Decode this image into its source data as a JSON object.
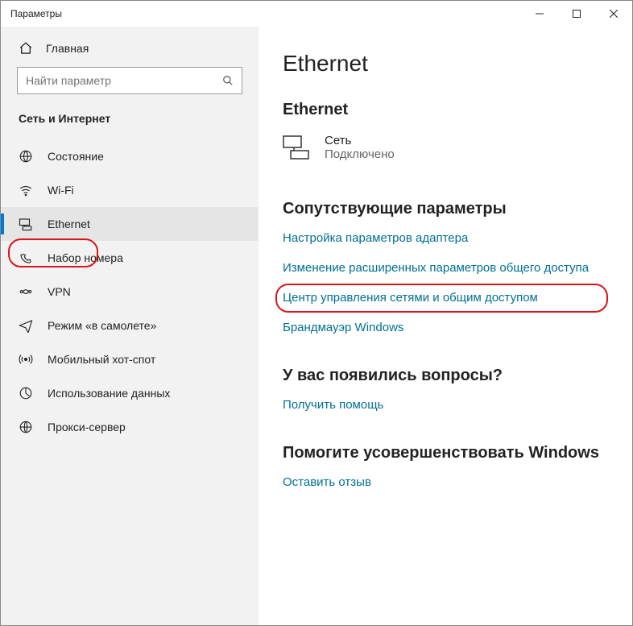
{
  "window": {
    "title": "Параметры"
  },
  "sidebar": {
    "home": "Главная",
    "search_placeholder": "Найти параметр",
    "section": "Сеть и Интернет",
    "items": [
      {
        "label": "Состояние"
      },
      {
        "label": "Wi-Fi"
      },
      {
        "label": "Ethernet"
      },
      {
        "label": "Набор номера"
      },
      {
        "label": "VPN"
      },
      {
        "label": "Режим «в самолете»"
      },
      {
        "label": "Мобильный хот-спот"
      },
      {
        "label": "Использование данных"
      },
      {
        "label": "Прокси-сервер"
      }
    ]
  },
  "main": {
    "title": "Ethernet",
    "subtitle": "Ethernet",
    "network": {
      "name": "Сеть",
      "status": "Подключено"
    },
    "related_title": "Сопутствующие параметры",
    "links": [
      "Настройка параметров адаптера",
      "Изменение расширенных параметров общего доступа",
      "Центр управления сетями и общим доступом",
      "Брандмауэр Windows"
    ],
    "questions_title": "У вас появились вопросы?",
    "questions_link": "Получить помощь",
    "improve_title": "Помогите усовершенствовать Windows",
    "improve_link": "Оставить отзыв"
  }
}
